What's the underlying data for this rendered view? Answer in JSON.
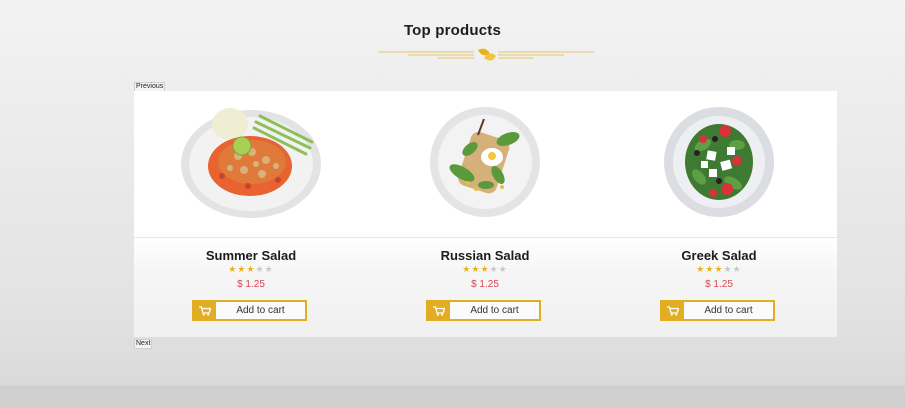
{
  "section": {
    "title": "Top products"
  },
  "carousel": {
    "previous_label": "Previous",
    "next_label": "Next"
  },
  "colors": {
    "accent": "#e1ae23",
    "price": "#d94855",
    "star_off": "#c9c9c9"
  },
  "products": [
    {
      "name": "Summer Salad",
      "rating": 3,
      "max_rating": 5,
      "price": "$ 1.25",
      "button": "Add to cart",
      "image": "summer-salad-plate"
    },
    {
      "name": "Russian Salad",
      "rating": 3,
      "max_rating": 5,
      "price": "$ 1.25",
      "button": "Add to cart",
      "image": "russian-salad-plate"
    },
    {
      "name": "Greek Salad",
      "rating": 3,
      "max_rating": 5,
      "price": "$ 1.25",
      "button": "Add to cart",
      "image": "greek-salad-plate"
    }
  ]
}
